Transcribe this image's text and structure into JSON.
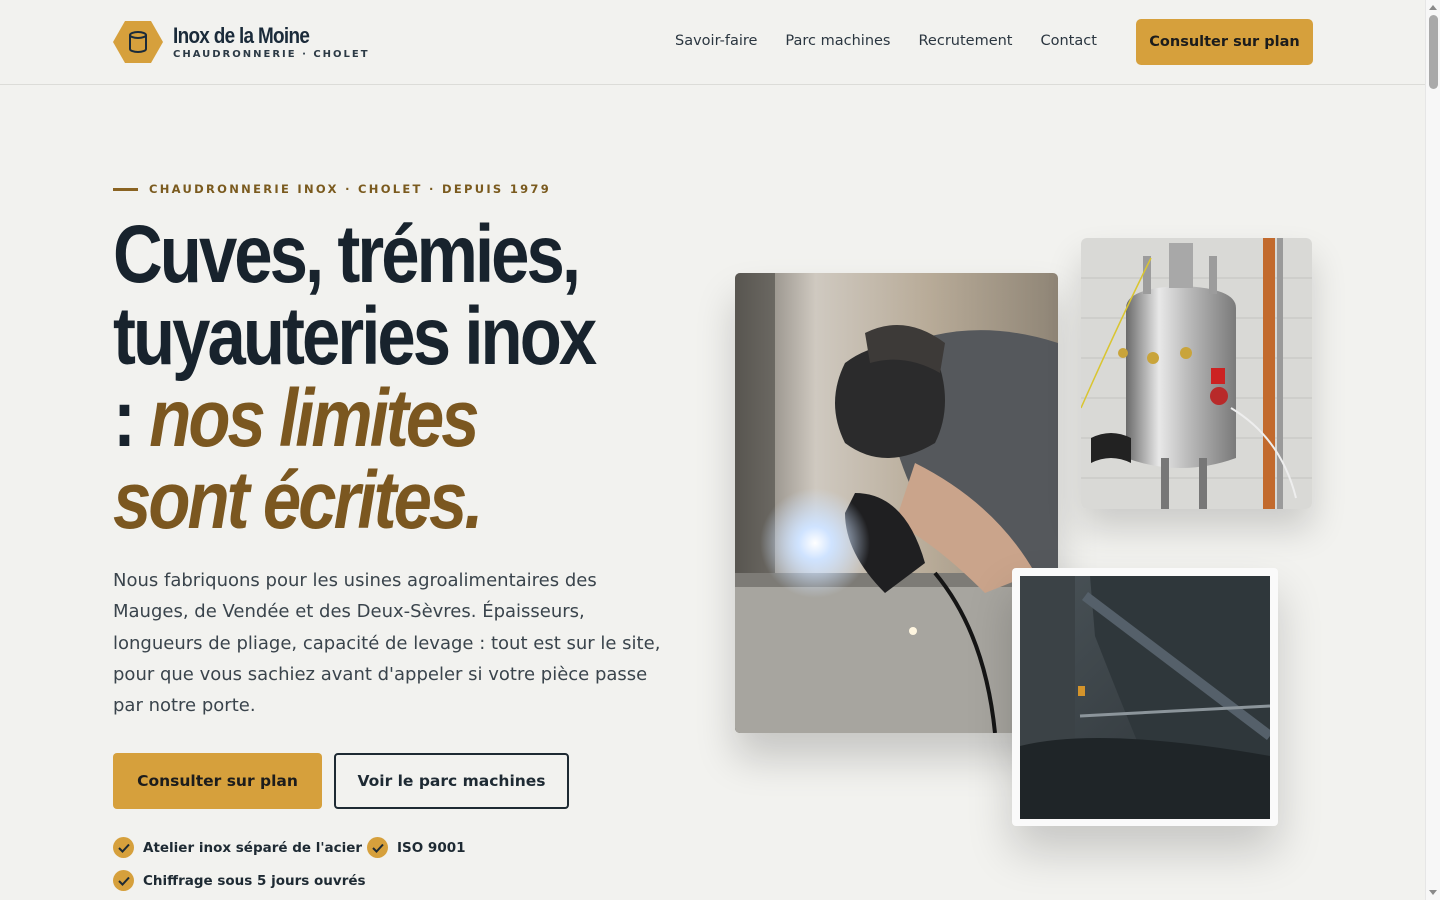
{
  "brand": {
    "name": "Inox de la Moine",
    "tagline": "CHAUDRONNERIE · CHOLET",
    "logo_icon": "barrel-icon",
    "accent_color": "#d6a03c",
    "dark_color": "#18232d",
    "brown_color": "#7b5720"
  },
  "nav": {
    "items": [
      {
        "label": "Savoir-faire"
      },
      {
        "label": "Parc machines"
      },
      {
        "label": "Recrutement"
      },
      {
        "label": "Contact"
      }
    ],
    "cta_label": "Consulter sur plan"
  },
  "hero": {
    "eyebrow": "CHAUDRONNERIE INOX · CHOLET · DEPUIS 1979",
    "headline_line1": "Cuves, trémies,",
    "headline_line2": "tuyauteries inox",
    "headline_colon": ": ",
    "headline_accent1": "nos limites",
    "headline_accent2": "sont écrites.",
    "intro": "Nous fabriquons pour les usines agroalimentaires des Mauges, de Vendée et des Deux-Sèvres. Épaisseurs, longueurs de pliage, capacité de levage : tout est sur le site, pour que vous sachiez avant d'appeler si votre pièce passe par notre porte.",
    "primary_cta": "Consulter sur plan",
    "secondary_cta": "Voir le parc machines",
    "badges": [
      {
        "label": "Atelier inox séparé de l'acier"
      },
      {
        "label": "ISO 9001"
      },
      {
        "label": "Chiffrage sous 5 jours ouvrés"
      }
    ]
  },
  "images": {
    "welder": "welder-photo",
    "tank": "stainless-tank-photo",
    "press": "press-brake-photo"
  }
}
